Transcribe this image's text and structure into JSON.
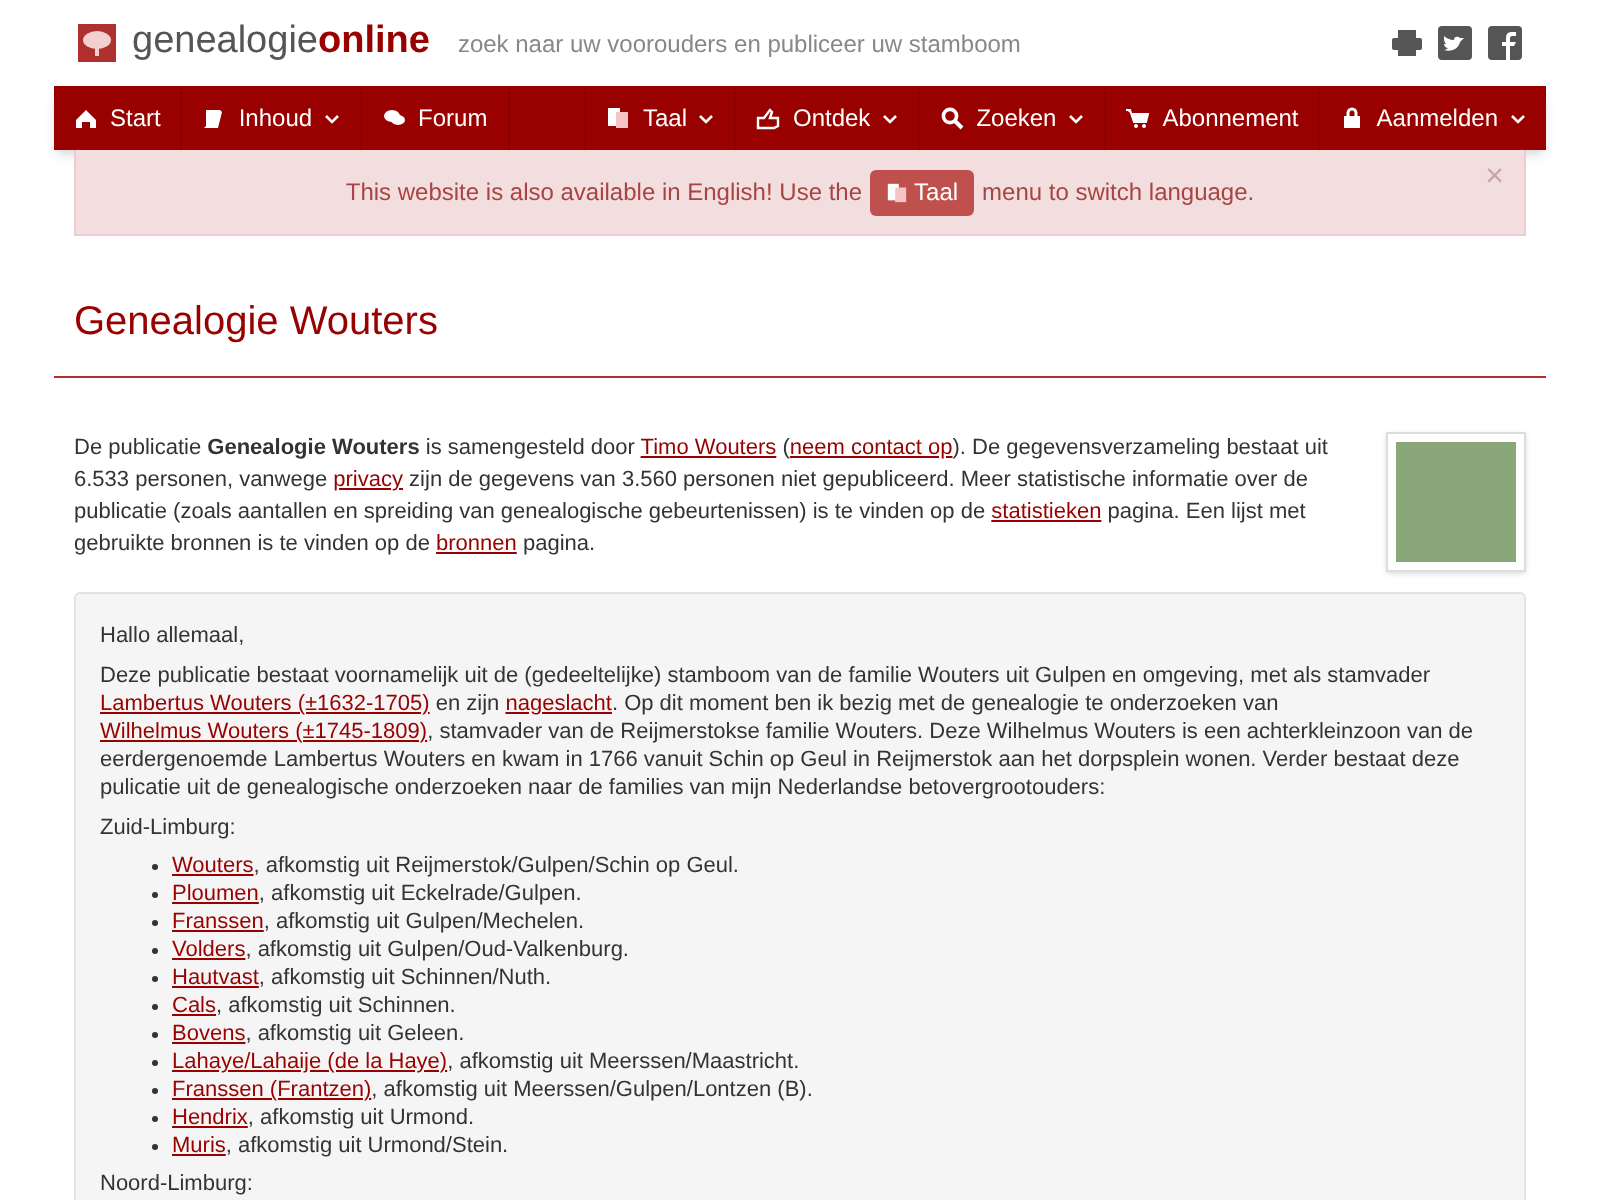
{
  "header": {
    "logo_plain": "genealogie",
    "logo_bold": "online",
    "tagline": "zoek naar uw voorouders en publiceer uw stamboom"
  },
  "nav": {
    "left": [
      {
        "label": "Start",
        "dropdown": false
      },
      {
        "label": "Inhoud",
        "dropdown": true
      },
      {
        "label": "Forum",
        "dropdown": false
      }
    ],
    "right": [
      {
        "label": "Taal",
        "dropdown": true
      },
      {
        "label": "Ontdek",
        "dropdown": true
      },
      {
        "label": "Zoeken",
        "dropdown": true
      },
      {
        "label": "Abonnement",
        "dropdown": false
      },
      {
        "label": "Aanmelden",
        "dropdown": true
      }
    ]
  },
  "alert": {
    "before": "This website is also available in English! Use the",
    "button": "Taal",
    "after": "menu to switch language.",
    "close": "×"
  },
  "title": "Genealogie Wouters",
  "intro": [
    {
      "kind": "text",
      "text": "De publicatie **Genealogie Wouters** is samengesteld door "
    },
    {
      "kind": "link",
      "text": "Timo Wouters"
    },
    {
      "kind": "text",
      "text": " ("
    },
    {
      "kind": "link",
      "text": "neem contact op"
    },
    {
      "kind": "text",
      "text": "). De gegevensverzameling bestaat uit 6.533 personen, vanwege "
    },
    {
      "kind": "link",
      "text": "privacy"
    },
    {
      "kind": "text",
      "text": " zijn de gegevens van 3.560 personen niet gepubliceerd. Meer statistische informatie over de publicatie (zoals aantallen en spreiding van genealogische gebeurtenissen) is te vinden op de "
    },
    {
      "kind": "link",
      "text": "statistieken"
    },
    {
      "kind": "text",
      "text": " pagina. Een lijst met gebruikte bronnen is te vinden op de "
    },
    {
      "kind": "link",
      "text": "bronnen"
    },
    {
      "kind": "text",
      "text": " pagina."
    }
  ],
  "box": {
    "greeting": "Hallo allemaal,",
    "paragraph": [
      {
        "kind": "text",
        "text": "Deze publicatie bestaat voornamelijk uit de (gedeeltelijke) stamboom van de familie Wouters uit Gulpen en omgeving, met als stamvader "
      },
      {
        "kind": "link",
        "text": "Lambertus Wouters (±1632-1705)"
      },
      {
        "kind": "text",
        "text": " en zijn "
      },
      {
        "kind": "link",
        "text": "nageslacht"
      },
      {
        "kind": "text",
        "text": ". Op dit moment ben ik bezig met de genealogie te onderzoeken van "
      },
      {
        "kind": "link",
        "text": "Wilhelmus Wouters (±1745-1809)"
      },
      {
        "kind": "text",
        "text": ", stamvader van de Reijmerstokse familie Wouters. Deze Wilhelmus Wouters is een achterkleinzoon van de eerdergenoemde Lambertus Wouters en kwam in 1766 vanuit Schin op Geul in Reijmerstok aan het dorpsplein wonen. Verder bestaat deze pulicatie uit de genealogische onderzoeken naar de families van mijn Nederlandse betovergrootouders:"
      }
    ],
    "sections": [
      {
        "heading": "Zuid-Limburg:",
        "families": [
          {
            "name": "Wouters",
            "origin": ", afkomstig uit Reijmerstok/Gulpen/Schin op Geul."
          },
          {
            "name": "Ploumen",
            "origin": ", afkomstig uit Eckelrade/Gulpen."
          },
          {
            "name": "Franssen",
            "origin": ", afkomstig uit Gulpen/Mechelen."
          },
          {
            "name": "Volders",
            "origin": ", afkomstig uit Gulpen/Oud-Valkenburg."
          },
          {
            "name": "Hautvast",
            "origin": ", afkomstig uit Schinnen/Nuth."
          },
          {
            "name": "Cals",
            "origin": ", afkomstig uit Schinnen."
          },
          {
            "name": "Bovens",
            "origin": ", afkomstig uit Geleen."
          },
          {
            "name": "Lahaye/Lahaije (de la Haye)",
            "origin": ", afkomstig uit Meerssen/Maastricht."
          },
          {
            "name": "Franssen (Frantzen)",
            "origin": ", afkomstig uit Meerssen/Gulpen/Lontzen (B)."
          },
          {
            "name": "Hendrix",
            "origin": ", afkomstig uit Urmond."
          },
          {
            "name": "Muris",
            "origin": ", afkomstig uit Urmond/Stein."
          }
        ]
      },
      {
        "heading": "Noord-Limburg:"
      }
    ]
  }
}
